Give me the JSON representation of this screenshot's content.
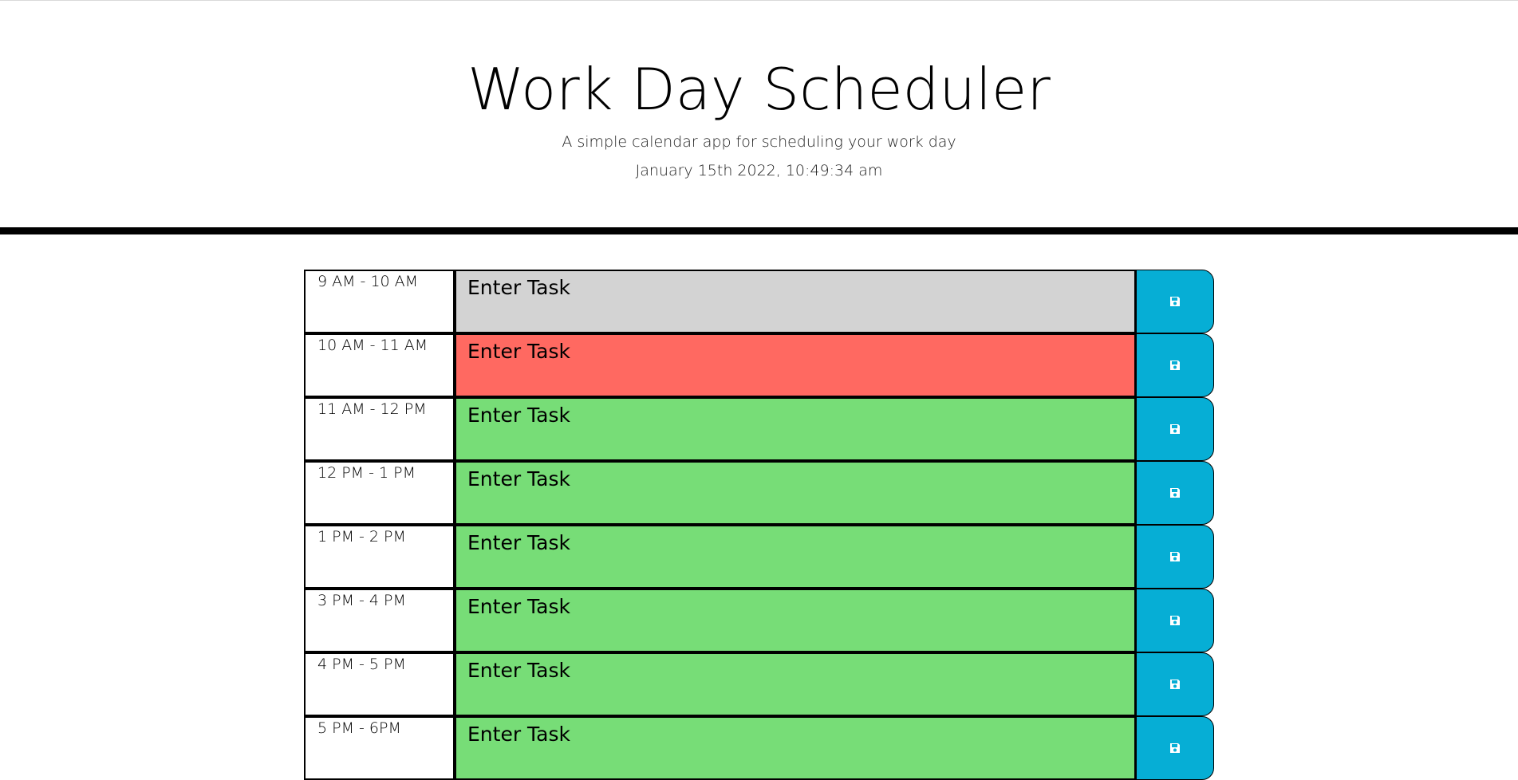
{
  "header": {
    "title": "Work Day Scheduler",
    "subtitle": "A simple calendar app for scheduling your work day",
    "current_day": "January 15th 2022, 10:49:34 am"
  },
  "colors": {
    "past": "#d3d3d3",
    "present": "#ff6961",
    "future": "#77dd77",
    "save_button": "#06aed5"
  },
  "rows": [
    {
      "hour": "9 AM - 10 AM",
      "placeholder": "Enter Task",
      "state": "past"
    },
    {
      "hour": "10 AM - 11 AM",
      "placeholder": "Enter Task",
      "state": "present"
    },
    {
      "hour": "11 AM - 12 PM",
      "placeholder": "Enter Task",
      "state": "future"
    },
    {
      "hour": "12 PM - 1 PM",
      "placeholder": "Enter Task",
      "state": "future"
    },
    {
      "hour": "1 PM - 2 PM",
      "placeholder": "Enter Task",
      "state": "future"
    },
    {
      "hour": "3 PM - 4 PM",
      "placeholder": "Enter Task",
      "state": "future"
    },
    {
      "hour": "4 PM - 5 PM",
      "placeholder": "Enter Task",
      "state": "future"
    },
    {
      "hour": "5 PM - 6PM",
      "placeholder": "Enter Task",
      "state": "future"
    }
  ],
  "icons": {
    "save": "floppy-disk-icon"
  }
}
